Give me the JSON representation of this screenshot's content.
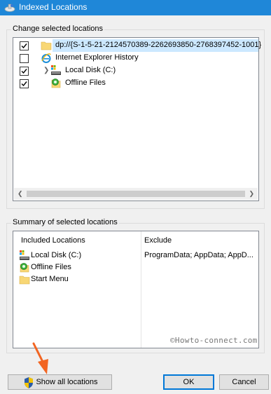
{
  "window": {
    "title": "Indexed Locations"
  },
  "change_group": {
    "label": "Change selected locations",
    "items": [
      {
        "label": "dp://{S-1-5-21-2124570389-2262693850-2768397452-1001}",
        "checked": true,
        "icon": "folder-icon",
        "selected": true
      },
      {
        "label": "Internet Explorer History",
        "checked": false,
        "icon": "internet-explorer-icon"
      },
      {
        "label": "Local Disk (C:)",
        "checked": true,
        "icon": "local-disk-icon",
        "expandable": true
      },
      {
        "label": "Offline Files",
        "checked": true,
        "icon": "offline-files-icon"
      }
    ]
  },
  "summary_group": {
    "label": "Summary of selected locations",
    "included_header": "Included Locations",
    "exclude_header": "Exclude",
    "included": [
      {
        "label": "Local Disk (C:)",
        "icon": "local-disk-icon"
      },
      {
        "label": "Offline Files",
        "icon": "offline-files-icon"
      },
      {
        "label": "Start Menu",
        "icon": "folder-icon"
      }
    ],
    "exclude_values": [
      "ProgramData; AppData; AppD..."
    ]
  },
  "watermark": "©Howto-connect.com",
  "buttons": {
    "show_all": "Show all locations",
    "ok": "OK",
    "cancel": "Cancel"
  },
  "colors": {
    "titlebar": "#1f87d8",
    "selection": "#cce8ff",
    "annotation_arrow": "#f26522"
  }
}
